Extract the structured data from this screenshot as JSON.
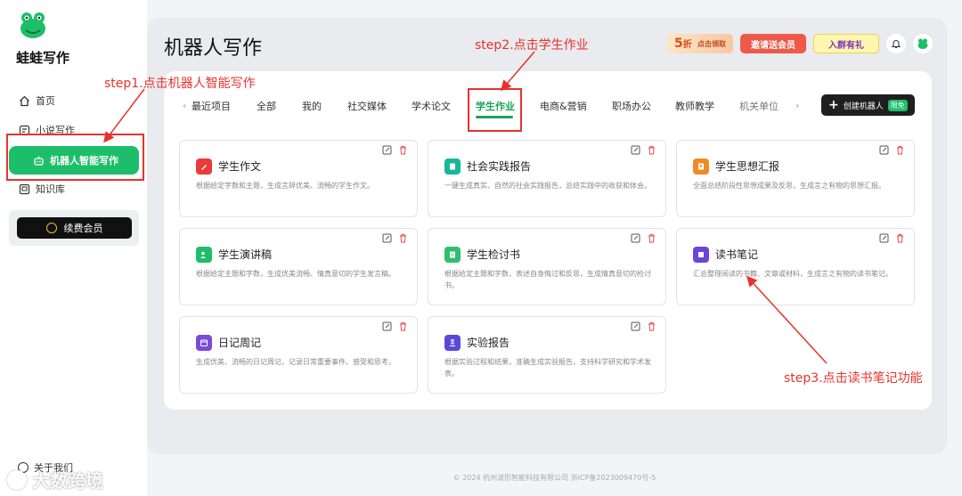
{
  "sidebar": {
    "brand": "蛙蛙写作",
    "items": [
      {
        "label": "首页",
        "icon": "home-icon"
      },
      {
        "label": "小说写作",
        "icon": "book-icon"
      },
      {
        "label": "机器人智能写作",
        "icon": "robot-icon"
      },
      {
        "label": "知识库",
        "icon": "library-icon"
      }
    ],
    "vip_label": "续费会员",
    "about_label": "关于我们"
  },
  "watermark": "大数跨境",
  "header": {
    "title": "机器人写作",
    "discount_big": "5",
    "discount_unit": "折",
    "discount_small": "点击领取",
    "invite_label": "邀请送会员",
    "group_label": "入群有礼"
  },
  "tabs": {
    "items": [
      "最近项目",
      "全部",
      "我的",
      "社交媒体",
      "学术论文",
      "学生作业",
      "电商&营销",
      "职场办公",
      "教师教学",
      "机关单位"
    ],
    "active": "学生作业",
    "create_label": "创建机器人",
    "free_label": "限免"
  },
  "cards": [
    {
      "title": "学生作文",
      "desc": "根据给定字数和主题，生成言辞优美、流畅的学生作文。",
      "color": "#ea3b3b",
      "icon": "pen-icon"
    },
    {
      "title": "社会实践报告",
      "desc": "一键生成真实、自然的社会实践报告，总结实践中的收获和体会。",
      "color": "#17b79a",
      "icon": "report-icon"
    },
    {
      "title": "学生思想汇报",
      "desc": "全面总结阶段性思想成果及反思，生成言之有物的思想汇报。",
      "color": "#f08a24",
      "icon": "idea-icon"
    },
    {
      "title": "学生演讲稿",
      "desc": "根据给定主题和字数，生成优美流畅、情真意切的学生发言稿。",
      "color": "#1dbe6a",
      "icon": "speaker-icon"
    },
    {
      "title": "学生检讨书",
      "desc": "根据给定主题和字数，表述自身悔过和反思，生成情真意切的检讨书。",
      "color": "#2fbf71",
      "icon": "document-icon"
    },
    {
      "title": "读书笔记",
      "desc": "汇总整理阅读的书籍、文章或材料，生成言之有物的读书笔记。",
      "color": "#6a45d8",
      "icon": "note-icon"
    },
    {
      "title": "日记周记",
      "desc": "生成优美、流畅的日记周记，记录日常重要事件、感受和思考。",
      "color": "#7b4bd8",
      "icon": "calendar-icon"
    },
    {
      "title": "实验报告",
      "desc": "根据实验过程和结果，准确生成实验报告，支持科学研究和学术发表。",
      "color": "#5a48d6",
      "icon": "microscope-icon"
    }
  ],
  "annotations": {
    "step1": "step1.点击机器人智能写作",
    "step2": "step2.点击学生作业",
    "step3": "step3.点击读书笔记功能"
  },
  "footer": "© 2024 杭州波形智能科技有限公司 浙ICP备2023009470号-5",
  "colors": {
    "brand_green": "#1dbe6a",
    "annotation_red": "#e8322d"
  }
}
